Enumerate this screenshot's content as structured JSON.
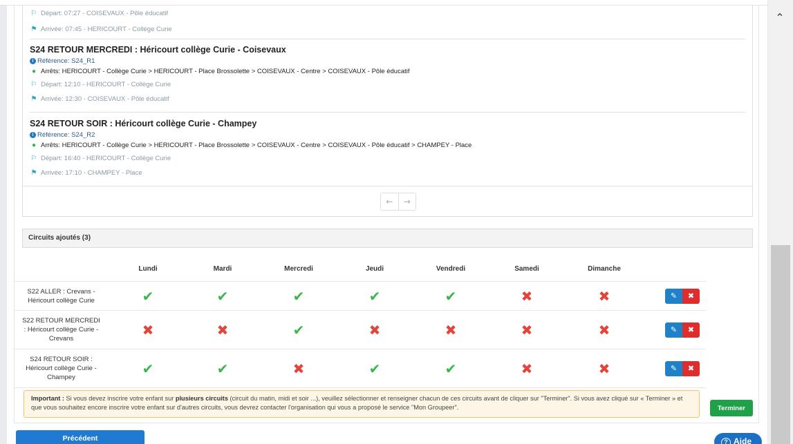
{
  "trips": [
    {
      "partial": true,
      "departure": "Départ: 07:27 - COISEVAUX - Pôle éducatif",
      "arrival": "Arrivée: 07:45 - HERICOURT - Collège Curie"
    },
    {
      "title": "S24 RETOUR MERCREDI : Héricourt collège Curie - Coisevaux",
      "reference": "Référence: S24_R1",
      "stops": "Arrêts: HERICOURT - Collège Curie > HERICOURT - Place Brossolette > COISEVAUX - Centre > COISEVAUX - Pôle éducatif",
      "departure": "Départ: 12:10 - HERICOURT - Collège Curie",
      "arrival": "Arrivée: 12:30 - COISEVAUX - Pôle éducatif"
    },
    {
      "title": "S24 RETOUR SOIR : Héricourt collège Curie - Champey",
      "reference": "Référence: S24_R2",
      "stops": "Arrêts: HERICOURT - Collège Curie > HERICOURT - Place Brossolette > COISEVAUX - Centre > COISEVAUX - Pôle éducatif > CHAMPEY - Place",
      "departure": "Départ: 16:40 - HERICOURT - Collège Curie",
      "arrival": "Arrivée: 17:10 - CHAMPEY - Place"
    }
  ],
  "pager": {
    "prev": "←",
    "next": "→"
  },
  "circuits": {
    "heading": "Circuits ajoutés (3)",
    "days": [
      "Lundi",
      "Mardi",
      "Mercredi",
      "Jeudi",
      "Vendredi",
      "Samedi",
      "Dimanche"
    ],
    "rows": [
      {
        "name": "S22 ALLER : Crevans - Héricourt collège Curie",
        "days": [
          true,
          true,
          true,
          true,
          true,
          false,
          false
        ]
      },
      {
        "name": "S22 RETOUR MERCREDI : Héricourt collège Curie - Crevans",
        "days": [
          false,
          false,
          true,
          false,
          false,
          false,
          false
        ]
      },
      {
        "name": "S24 RETOUR SOIR : Héricourt collège Curie - Champey",
        "days": [
          true,
          true,
          false,
          true,
          true,
          false,
          false
        ]
      }
    ],
    "yes_glyph": "✔",
    "no_glyph": "✖",
    "edit_glyph": "✎",
    "delete_glyph": "✖"
  },
  "notice": {
    "important": "Important :",
    "part1": " Si vous devez inscrire votre enfant sur ",
    "bold": "plusieurs circuits",
    "part2": " (circuit du matin, midi et soir ...), veuillez sélectionner et renseigner chacun de ces circuits avant de cliquer sur \"Terminer\". Si vous avez cliqué sur « Terminer » et que vous souhaitez encore inscrire votre enfant sur d'autres circuits, vous devrez contacter l'organisation qui vous a proposé le service \"Mon Groupeer\"."
  },
  "buttons": {
    "finish": "Terminer",
    "previous": "Précédent",
    "help": "Aide"
  },
  "icons": {
    "info": "info-icon",
    "pin": "map-pin-icon",
    "flag_out": "flag-outline-icon",
    "flag_in": "flag-checkered-icon",
    "help": "question-circle-icon",
    "scroll_up": "chevron-up-icon"
  },
  "colors": {
    "check": "#3cb64a",
    "cross": "#e0463c",
    "primary": "#1f7ad0",
    "success": "#1fa14a"
  }
}
